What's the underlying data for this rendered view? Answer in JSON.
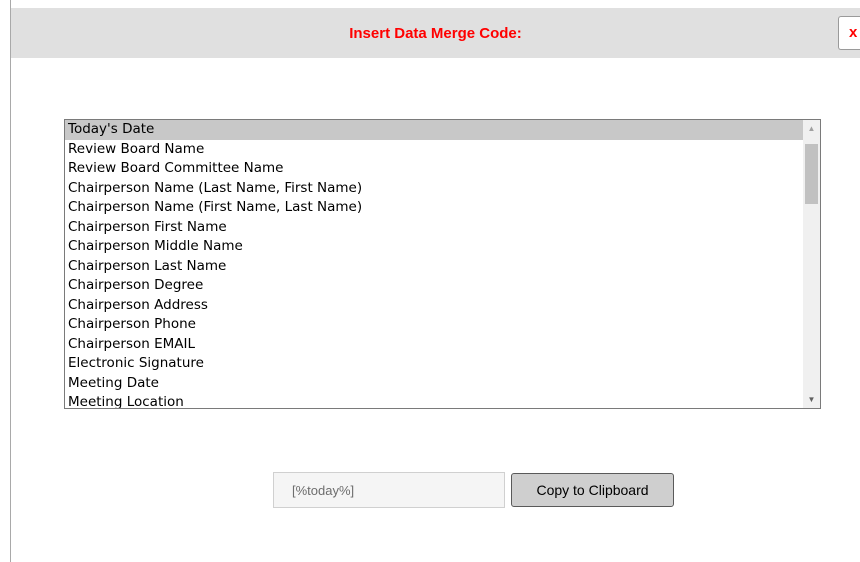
{
  "dialog": {
    "title": "Insert Data Merge Code:",
    "close_label": "x"
  },
  "merge_codes": {
    "selected_index": 0,
    "items": [
      "Today's Date",
      "Review Board Name",
      "Review Board Committee Name",
      "Chairperson Name (Last Name, First Name)",
      "Chairperson Name (First Name, Last Name)",
      "Chairperson First Name",
      "Chairperson Middle Name",
      "Chairperson Last Name",
      "Chairperson Degree",
      "Chairperson Address",
      "Chairperson Phone",
      "Chairperson EMAIL",
      "Electronic Signature",
      "Meeting Date",
      "Meeting Location"
    ]
  },
  "code_field": {
    "value": "[%today%]"
  },
  "copy_button": {
    "label": "Copy to Clipboard"
  },
  "colors": {
    "title": "#ff0000",
    "titlebar_bg": "#e0e0e0",
    "selected_item_bg": "#c8c8c8"
  }
}
